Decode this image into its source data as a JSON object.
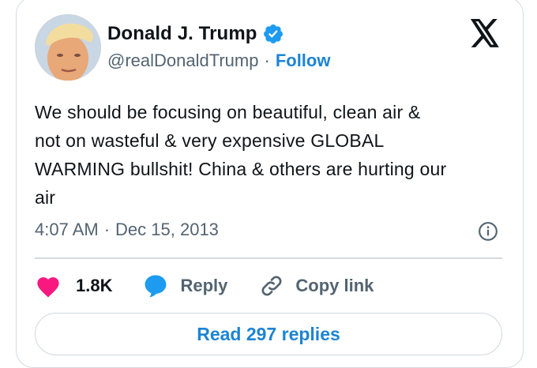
{
  "author": {
    "name": "Donald J. Trump",
    "handle": "@realDonaldTrump",
    "separator": "·",
    "follow_label": "Follow"
  },
  "platform_icon": "x-logo-icon",
  "tweet": {
    "lines": [
      "We should be focusing on beautiful, clean air &",
      "not on wasteful & very expensive GLOBAL",
      "WARMING bullshit! China & others are hurting our",
      "air"
    ],
    "time": "4:07 AM",
    "separator": "·",
    "date": "Dec 15, 2013"
  },
  "actions": {
    "like_count": "1.8K",
    "reply_label": "Reply",
    "copy_link_label": "Copy link"
  },
  "read_replies_label": "Read 297 replies",
  "colors": {
    "accent": "#1d84d4",
    "heart": "#f91880",
    "reply_bubble": "#1d9bf0",
    "secondary_text": "#536471",
    "border": "#d5dadf"
  }
}
